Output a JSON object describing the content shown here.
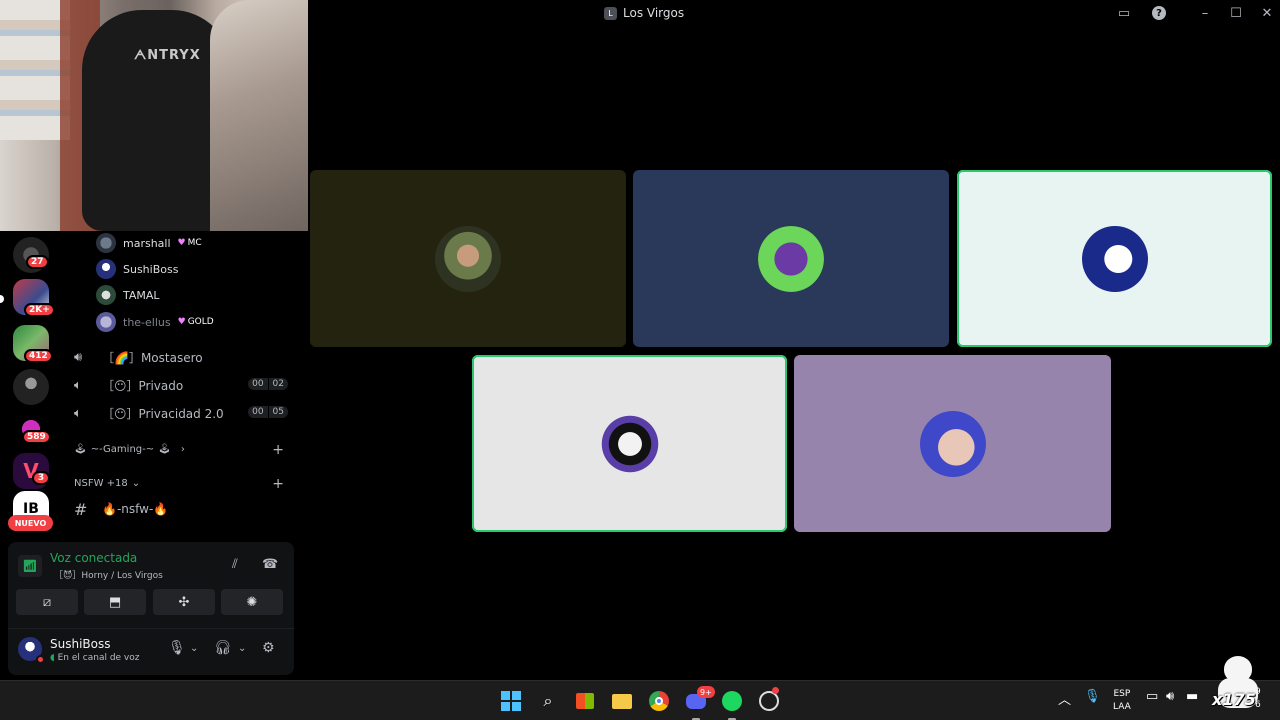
{
  "window": {
    "title": "Los Virgos"
  },
  "servers": [
    {
      "badge": "27"
    },
    {
      "badge": "2K+"
    },
    {
      "badge": "412"
    },
    {
      "badge": ""
    },
    {
      "badge": "589"
    },
    {
      "badge": "3"
    },
    {
      "badge": ""
    }
  ],
  "servers_new_label": "NUEVO",
  "members": [
    {
      "name": "marshall",
      "tag": "MC"
    },
    {
      "name": "SushiBoss",
      "tag": ""
    },
    {
      "name": "TAMAL",
      "tag": ""
    },
    {
      "name": "the-ellus",
      "tag": "GOLD"
    }
  ],
  "voice_channels": [
    {
      "name": "［🌈］Mostasero",
      "count_a": "",
      "count_b": ""
    },
    {
      "name": "［😶］Privado",
      "count_a": "00",
      "count_b": "02"
    },
    {
      "name": "［😶］Privacidad 2.0",
      "count_a": "00",
      "count_b": "05"
    }
  ],
  "categories": [
    {
      "name": "~-Gaming-~"
    },
    {
      "name": "NSFW +18"
    }
  ],
  "text_channel": {
    "name": "🔥-nsfw-🔥"
  },
  "voice_panel": {
    "status": "Voz conectada",
    "location": "［😈］Horny / Los Virgos"
  },
  "user": {
    "name": "SushiBoss",
    "status": "En el canal de voz"
  },
  "tiles": [
    {
      "bg": "#24230f",
      "speaking": false
    },
    {
      "bg": "#2a3859",
      "speaking": false
    },
    {
      "bg": "#e8f4f1",
      "speaking": true
    },
    {
      "bg": "#e6e6e6",
      "speaking": true
    },
    {
      "bg": "#9784ac",
      "speaking": false
    }
  ],
  "tray": {
    "lang_top": "ESP",
    "lang_bottom": "LAA",
    "clock_top": "9",
    "clock_bottom": "6"
  },
  "taskbar_badges": {
    "discord": "9+"
  },
  "overlay": {
    "watermark": "x175"
  },
  "accent": {
    "speaking": "#2dc770",
    "danger": "#f23f43",
    "online": "#23a55a"
  }
}
